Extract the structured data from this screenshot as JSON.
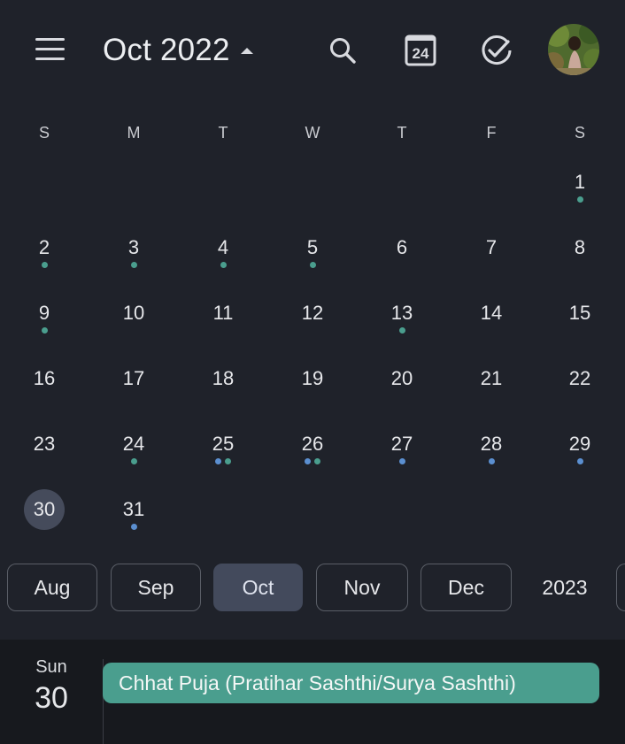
{
  "header": {
    "title": "Oct 2022",
    "today_badge": "24"
  },
  "weekdays": [
    "S",
    "M",
    "T",
    "W",
    "T",
    "F",
    "S"
  ],
  "colors": {
    "background": "#1f222a",
    "dot_green": "#4a9e8e",
    "dot_blue": "#5b8fd0",
    "selected_bg": "#454b5b",
    "event_bg": "#4a9e8e"
  },
  "days": [
    {
      "label": "1",
      "dots": [
        "green"
      ]
    },
    {
      "label": "2",
      "dots": [
        "green"
      ]
    },
    {
      "label": "3",
      "dots": [
        "green"
      ]
    },
    {
      "label": "4",
      "dots": [
        "green"
      ]
    },
    {
      "label": "5",
      "dots": [
        "green"
      ]
    },
    {
      "label": "6",
      "dots": []
    },
    {
      "label": "7",
      "dots": []
    },
    {
      "label": "8",
      "dots": []
    },
    {
      "label": "9",
      "dots": [
        "green"
      ]
    },
    {
      "label": "10",
      "dots": []
    },
    {
      "label": "11",
      "dots": []
    },
    {
      "label": "12",
      "dots": []
    },
    {
      "label": "13",
      "dots": [
        "green"
      ]
    },
    {
      "label": "14",
      "dots": []
    },
    {
      "label": "15",
      "dots": []
    },
    {
      "label": "16",
      "dots": []
    },
    {
      "label": "17",
      "dots": []
    },
    {
      "label": "18",
      "dots": []
    },
    {
      "label": "19",
      "dots": []
    },
    {
      "label": "20",
      "dots": []
    },
    {
      "label": "21",
      "dots": []
    },
    {
      "label": "22",
      "dots": []
    },
    {
      "label": "23",
      "dots": []
    },
    {
      "label": "24",
      "dots": [
        "green"
      ]
    },
    {
      "label": "25",
      "dots": [
        "blue",
        "green"
      ]
    },
    {
      "label": "26",
      "dots": [
        "blue",
        "green"
      ]
    },
    {
      "label": "27",
      "dots": [
        "blue"
      ]
    },
    {
      "label": "28",
      "dots": [
        "blue"
      ]
    },
    {
      "label": "29",
      "dots": [
        "blue"
      ]
    },
    {
      "label": "30",
      "dots": [],
      "selected": true
    },
    {
      "label": "31",
      "dots": [
        "blue"
      ]
    }
  ],
  "months": [
    {
      "label": "Aug",
      "active": false
    },
    {
      "label": "Sep",
      "active": false
    },
    {
      "label": "Oct",
      "active": true
    },
    {
      "label": "Nov",
      "active": false
    },
    {
      "label": "Dec",
      "active": false
    },
    {
      "label": "2023",
      "active": false,
      "plain": true
    }
  ],
  "agenda": {
    "day_of_week": "Sun",
    "date": "30",
    "events": [
      {
        "title": "Chhat Puja (Pratihar Sashthi/Surya Sashthi)"
      }
    ]
  }
}
